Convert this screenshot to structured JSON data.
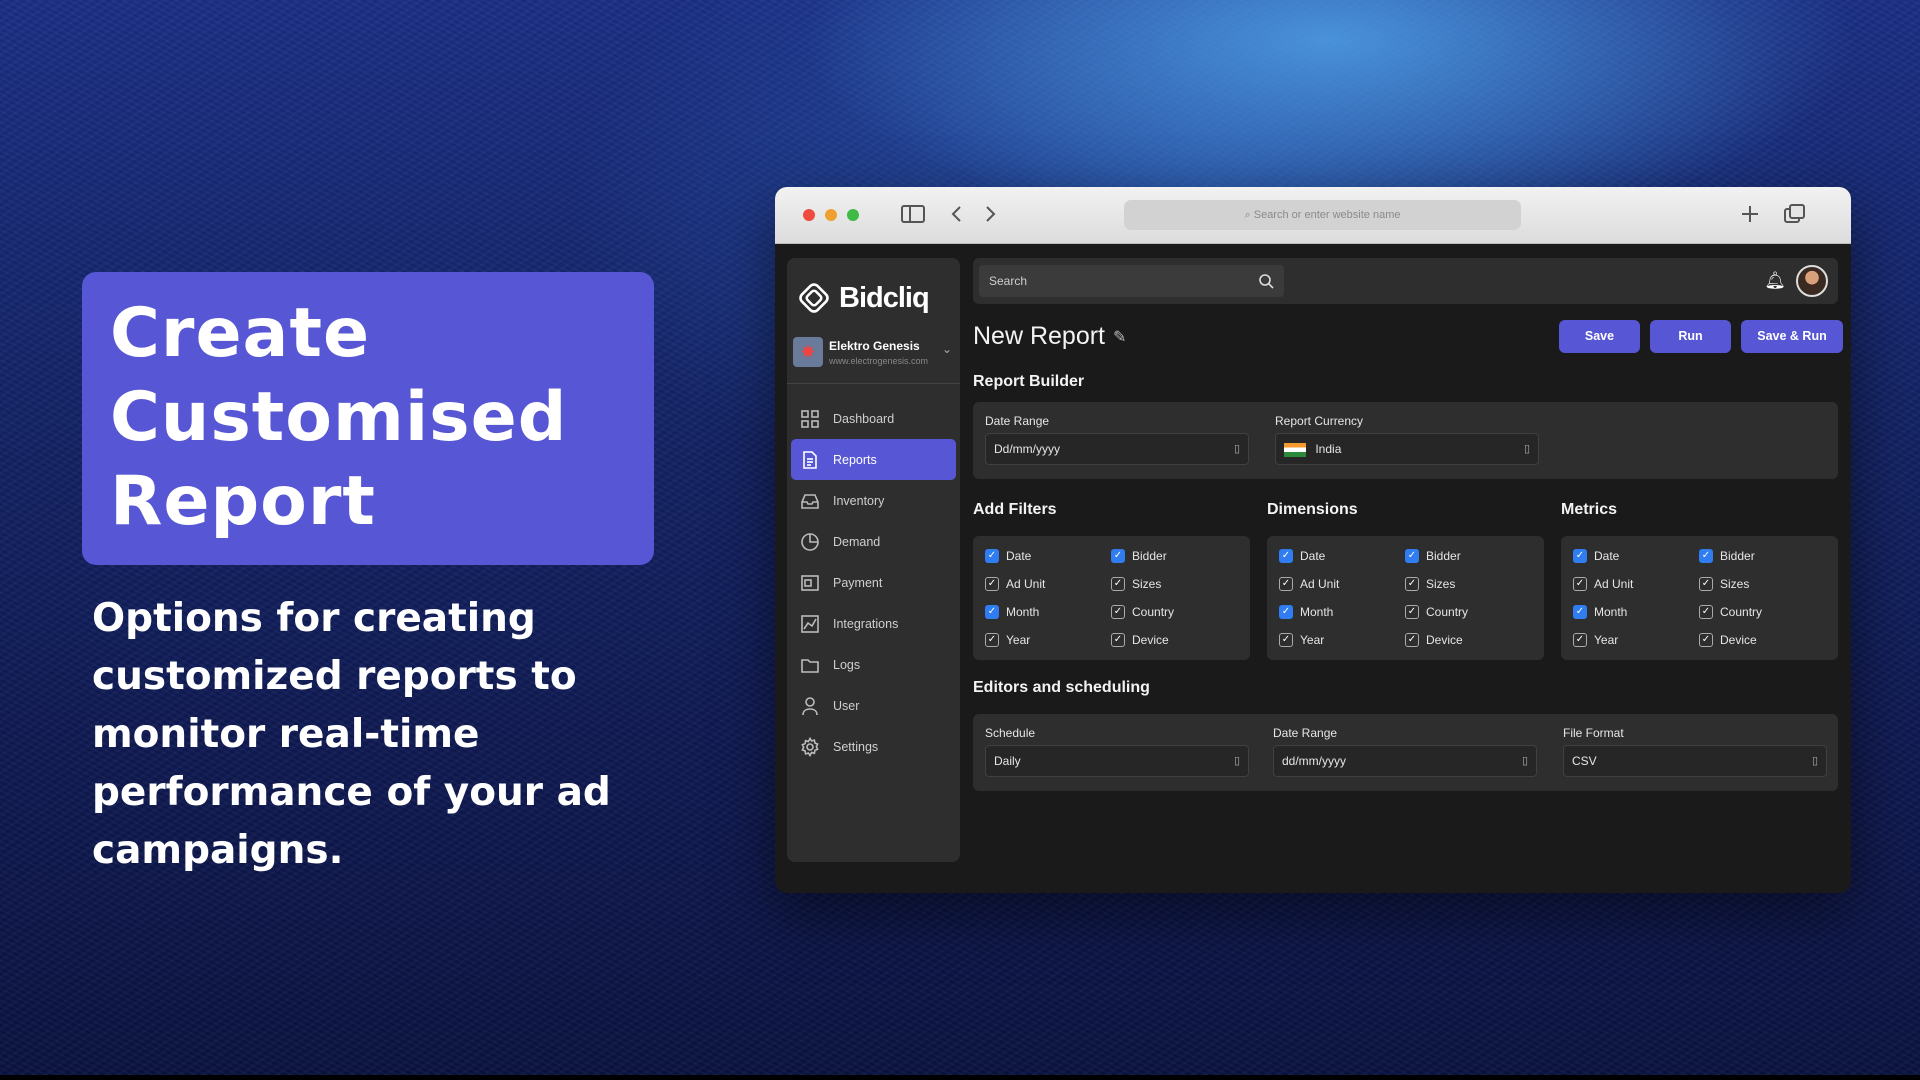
{
  "hero": {
    "title_lines": [
      "Create",
      "Customised",
      "Report"
    ],
    "subtitle": "Options for creating customized reports to monitor real-time performance of your ad campaigns."
  },
  "browser": {
    "url_placeholder": "Search or enter website name"
  },
  "app": {
    "logo": "Bidcliq",
    "org": {
      "name": "Elektro Genesis",
      "url": "www.electrogenesis.com"
    },
    "nav": [
      {
        "label": "Dashboard",
        "icon": "grid-icon"
      },
      {
        "label": "Reports",
        "icon": "document-icon",
        "active": true
      },
      {
        "label": "Inventory",
        "icon": "inbox-icon"
      },
      {
        "label": "Demand",
        "icon": "pie-chart-icon"
      },
      {
        "label": "Payment",
        "icon": "payment-icon"
      },
      {
        "label": "Integrations",
        "icon": "chart-icon"
      },
      {
        "label": "Logs",
        "icon": "folder-icon"
      },
      {
        "label": "User",
        "icon": "user-icon"
      },
      {
        "label": "Settings",
        "icon": "gear-icon"
      }
    ],
    "search_placeholder": "Search",
    "page_title": "New Report",
    "buttons": {
      "save": "Save",
      "run": "Run",
      "save_run": "Save & Run"
    },
    "report_builder": {
      "title": "Report Builder",
      "date_range_label": "Date Range",
      "date_range_value": "Dd/mm/yyyy",
      "currency_label": "Report Currency",
      "currency_value": "India"
    },
    "filters": {
      "title": "Add Filters",
      "items": [
        {
          "label": "Date",
          "checked": true
        },
        {
          "label": "Bidder",
          "checked": true
        },
        {
          "label": "Ad Unit",
          "checked": false
        },
        {
          "label": "Sizes",
          "checked": false
        },
        {
          "label": "Month",
          "checked": true
        },
        {
          "label": "Country",
          "checked": false
        },
        {
          "label": "Year",
          "checked": false
        },
        {
          "label": "Device",
          "checked": false
        }
      ]
    },
    "dimensions": {
      "title": "Dimensions",
      "items": [
        {
          "label": "Date",
          "checked": true
        },
        {
          "label": "Bidder",
          "checked": true
        },
        {
          "label": "Ad Unit",
          "checked": false
        },
        {
          "label": "Sizes",
          "checked": false
        },
        {
          "label": "Month",
          "checked": true
        },
        {
          "label": "Country",
          "checked": false
        },
        {
          "label": "Year",
          "checked": false
        },
        {
          "label": "Device",
          "checked": false
        }
      ]
    },
    "metrics": {
      "title": "Metrics",
      "items": [
        {
          "label": "Date",
          "checked": true
        },
        {
          "label": "Bidder",
          "checked": true
        },
        {
          "label": "Ad Unit",
          "checked": false
        },
        {
          "label": "Sizes",
          "checked": false
        },
        {
          "label": "Month",
          "checked": true
        },
        {
          "label": "Country",
          "checked": false
        },
        {
          "label": "Year",
          "checked": false
        },
        {
          "label": "Device",
          "checked": false
        }
      ]
    },
    "scheduling": {
      "title": "Editors and scheduling",
      "schedule_label": "Schedule",
      "schedule_value": "Daily",
      "date_range_label": "Date Range",
      "date_range_value": "dd/mm/yyyy",
      "file_format_label": "File Format",
      "file_format_value": "CSV"
    }
  },
  "colors": {
    "accent": "#5757d6",
    "checkbox": "#2f7df0"
  }
}
